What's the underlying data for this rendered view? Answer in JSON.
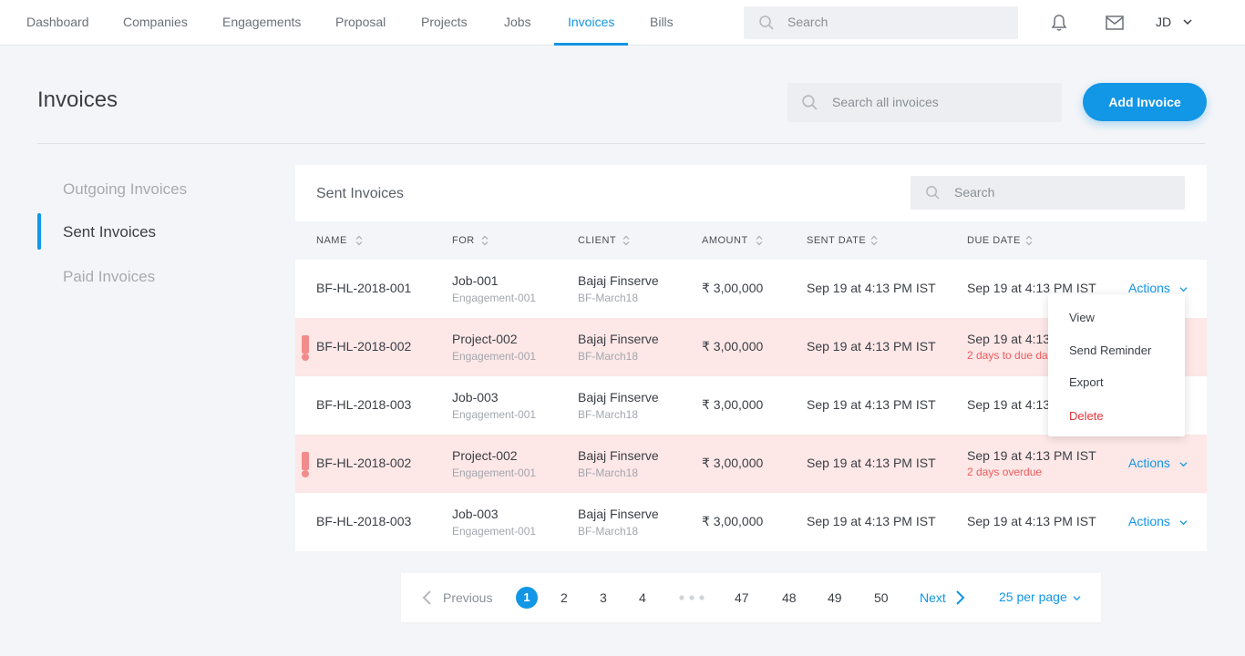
{
  "nav": {
    "items": [
      {
        "label": "Dashboard",
        "active": false
      },
      {
        "label": "Companies",
        "active": false
      },
      {
        "label": "Engagements",
        "active": false
      },
      {
        "label": "Proposal",
        "active": false
      },
      {
        "label": "Projects",
        "active": false
      },
      {
        "label": "Jobs",
        "active": false
      },
      {
        "label": "Invoices",
        "active": true
      },
      {
        "label": "Bills",
        "active": false
      }
    ],
    "search_placeholder": "Search",
    "user_initials": "JD"
  },
  "page": {
    "title": "Invoices",
    "search_placeholder": "Search all invoices",
    "add_button": "Add Invoice"
  },
  "sidebar": {
    "items": [
      {
        "label": "Outgoing Invoices",
        "active": false
      },
      {
        "label": "Sent Invoices",
        "active": true
      },
      {
        "label": "Paid Invoices",
        "active": false
      }
    ]
  },
  "table": {
    "title": "Sent Invoices",
    "search_placeholder": "Search",
    "columns": [
      "NAME",
      "FOR",
      "CLIENT",
      "AMOUNT",
      "SENT DATE",
      "DUE DATE"
    ],
    "actions_label": "Actions",
    "rows": [
      {
        "name": "BF-HL-2018-001",
        "for": "Job-001",
        "for_sub": "Engagement-001",
        "client": "Bajaj Finserve",
        "client_sub": "BF-March18",
        "amount": "₹ 3,00,000",
        "sent": "Sep 19 at 4:13 PM IST",
        "due": "Sep 19 at 4:13 PM IST",
        "due_note": "",
        "alert": false
      },
      {
        "name": "BF-HL-2018-002",
        "for": "Project-002",
        "for_sub": "Engagement-001",
        "client": "Bajaj Finserve",
        "client_sub": "BF-March18",
        "amount": "₹ 3,00,000",
        "sent": "Sep 19 at 4:13 PM IST",
        "due": "Sep 19 at 4:13 PM IST",
        "due_note": "2 days to due date",
        "alert": true
      },
      {
        "name": "BF-HL-2018-003",
        "for": "Job-003",
        "for_sub": "Engagement-001",
        "client": "Bajaj Finserve",
        "client_sub": "BF-March18",
        "amount": "₹ 3,00,000",
        "sent": "Sep 19 at 4:13 PM IST",
        "due": "Sep 19 at 4:13 PM IST",
        "due_note": "",
        "alert": false
      },
      {
        "name": "BF-HL-2018-002",
        "for": "Project-002",
        "for_sub": "Engagement-001",
        "client": "Bajaj Finserve",
        "client_sub": "BF-March18",
        "amount": "₹ 3,00,000",
        "sent": "Sep 19 at 4:13 PM IST",
        "due": "Sep 19 at 4:13 PM IST",
        "due_note": "2 days overdue",
        "alert": true
      },
      {
        "name": "BF-HL-2018-003",
        "for": "Job-003",
        "for_sub": "Engagement-001",
        "client": "Bajaj Finserve",
        "client_sub": "BF-March18",
        "amount": "₹ 3,00,000",
        "sent": "Sep 19 at 4:13 PM IST",
        "due": "Sep 19 at 4:13 PM IST",
        "due_note": "",
        "alert": false
      }
    ]
  },
  "dropdown": {
    "items": [
      "View",
      "Send Reminder",
      "Export",
      "Delete"
    ]
  },
  "pagination": {
    "previous": "Previous",
    "current": "1",
    "pages": [
      "2",
      "3",
      "4",
      "47",
      "48",
      "49",
      "50"
    ],
    "next": "Next",
    "per_page": "25 per page"
  },
  "colors": {
    "accent": "#1296e6",
    "alert_row": "#fde7e7",
    "alert_flag": "#f28b8b",
    "danger": "#e8333a"
  },
  "icons": {
    "search": "search-icon",
    "bell": "bell-icon",
    "mail": "mail-icon",
    "sort": "sort-icon",
    "chevron": "chevron-down-icon",
    "alert": "alert-icon"
  }
}
